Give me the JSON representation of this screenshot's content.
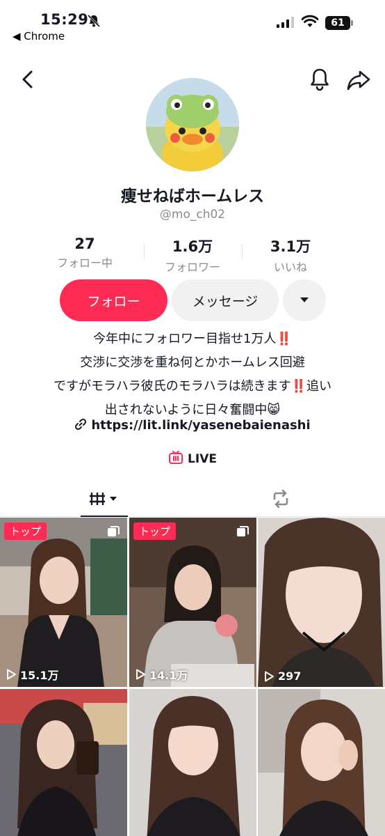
{
  "status_bar": {
    "time": "15:29",
    "back_app": "◀ Chrome",
    "battery": "61"
  },
  "profile": {
    "display_name": "痩せねばホームレス",
    "handle": "@mo_ch02",
    "stats": [
      {
        "value": "27",
        "label": "フォロー中"
      },
      {
        "value": "1.6万",
        "label": "フォロワー"
      },
      {
        "value": "3.1万",
        "label": "いいね"
      }
    ],
    "follow_label": "フォロー",
    "message_label": "メッセージ",
    "bio": {
      "line1": "今年中にフォロワー目指せ1万人",
      "line1_mark": "‼️",
      "line2": "交渉に交渉を重ね何とかホームレス回避",
      "line3_a": "ですがモラハラ彼氏のモラハラは続きます",
      "line3_mark": "‼️",
      "line3_b": "追い",
      "line4": "出されないように日々奮闘中😸"
    },
    "link": "https://lit.link/yasenebaienashi",
    "live_label": "LIVE"
  },
  "tabs": [
    {
      "icon": "grid-icon",
      "active": true
    },
    {
      "icon": "repost-icon",
      "active": false
    }
  ],
  "videos": [
    {
      "badge": "トップ",
      "views": "15.1万",
      "multi": true
    },
    {
      "badge": "トップ",
      "views": "14.1万",
      "multi": true
    },
    {
      "badge": "",
      "views": "297",
      "multi": false
    },
    {
      "badge": "",
      "views": "",
      "multi": false
    },
    {
      "badge": "",
      "views": "",
      "multi": false
    },
    {
      "badge": "",
      "views": "",
      "multi": false
    }
  ],
  "colors": {
    "accent": "#fe2c55",
    "text": "#161823",
    "muted": "#8a8b91"
  }
}
